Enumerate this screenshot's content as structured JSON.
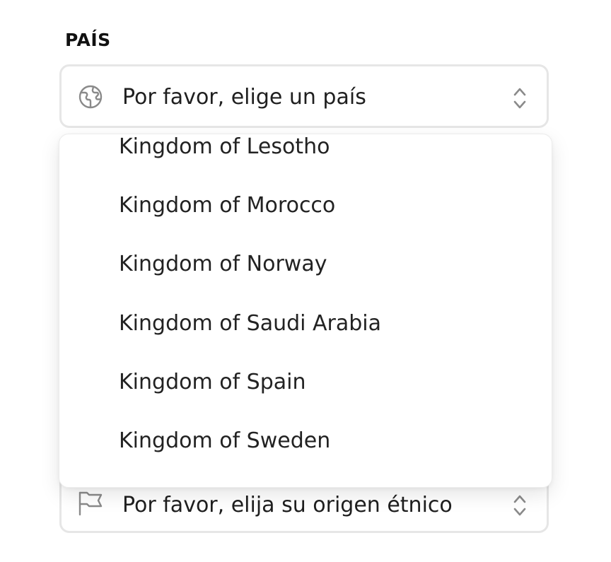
{
  "country_field": {
    "label": "PAÍS",
    "placeholder": "Por favor, elige un país",
    "icon": "globe-icon",
    "dropdown_icon": "chevron-updown-icon",
    "options": [
      "Kingdom of Lesotho",
      "Kingdom of Morocco",
      "Kingdom of Norway",
      "Kingdom of Saudi Arabia",
      "Kingdom of Spain",
      "Kingdom of Sweden"
    ]
  },
  "ethnic_field": {
    "placeholder": "Por favor, elija su origen étnico",
    "icon": "flag-icon",
    "dropdown_icon": "chevron-updown-icon"
  },
  "colors": {
    "border": "#e6e6e6",
    "text": "#1f1f1f",
    "icon": "#8a8a8a"
  }
}
